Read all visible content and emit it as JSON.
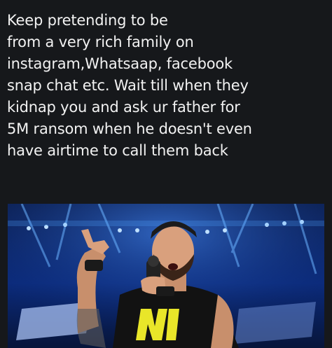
{
  "caption": {
    "lines": [
      "Keep pretending to be",
      "from a very rich family on",
      "instagram,Whatsaap, facebook",
      "snap chat etc. Wait till when they",
      "kidnap you and ask ur father for",
      "5M ransom when he doesn't even",
      "have airtime to call them back"
    ]
  },
  "photo": {
    "description_icon": "wrestler-photo",
    "colors": {
      "background": "#0b2a7a",
      "stage_light": "#4fa3ff",
      "skin": "#d9a07d",
      "shirt": "#121212",
      "shirt_logo": "#e9e629"
    }
  }
}
